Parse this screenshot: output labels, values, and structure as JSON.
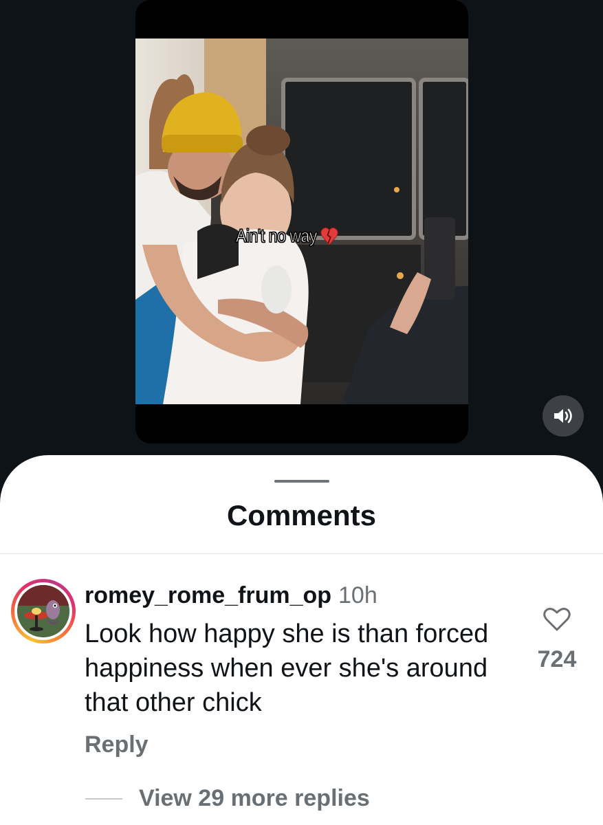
{
  "video": {
    "caption_text": "Ain't no way",
    "caption_emoji": "broken-heart-icon",
    "sound_icon": "speaker-volume-icon"
  },
  "comments_sheet": {
    "title": "Comments",
    "comment": {
      "username": "romey_rome_frum_op",
      "timestamp": "10h",
      "text": "Look how happy she is than forced happiness when ever she's around that other chick",
      "like_icon": "heart-outline-icon",
      "like_count": "724",
      "reply_label": "Reply",
      "view_replies_label": "View 29 more replies"
    }
  },
  "colors": {
    "background": "#0d1317",
    "sheet": "#ffffff",
    "primary_text": "#101418",
    "secondary_text": "#6a6f74",
    "caption_heart": "#e23b3b"
  }
}
